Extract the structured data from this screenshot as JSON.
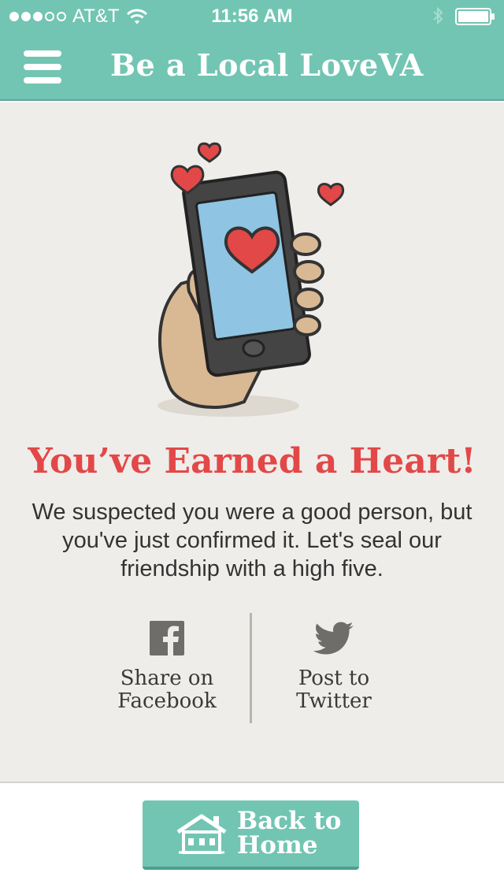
{
  "status_bar": {
    "carrier": "AT&T",
    "time": "11:56 AM",
    "signal_bars_filled": 3,
    "signal_bars_total": 5
  },
  "nav": {
    "title": "Be a Local LoveVA",
    "menu_icon": "hamburger-menu-icon"
  },
  "main": {
    "headline": "You’ve Earned a Heart!",
    "body": "We suspected you were a good person, but you've just confirmed it. Let's seal our friendship with a high five.",
    "illustration": "hand-holding-phone-with-hearts"
  },
  "share": {
    "facebook_label": "Share on\nFacebook",
    "twitter_label": "Post to\nTwitter"
  },
  "footer": {
    "home_button_label": "Back to\nHome"
  },
  "colors": {
    "brand_teal": "#72c5b3",
    "headline_red": "#e24848",
    "paper": "#efedea",
    "text": "#333333"
  }
}
